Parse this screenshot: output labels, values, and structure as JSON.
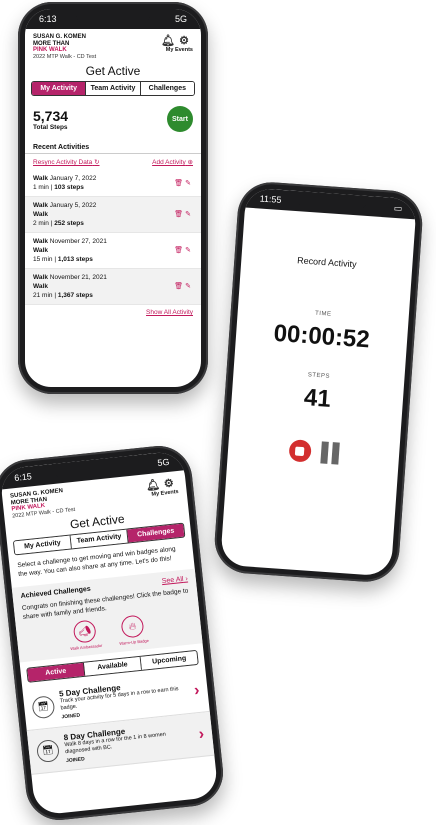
{
  "phone1": {
    "status": {
      "time": "6:13",
      "network": "5G"
    },
    "header": {
      "logo_line1": "SUSAN G. KOMEN",
      "logo_line2": "MORE THAN",
      "logo_line3": "PINK WALK",
      "logo_sub": "2022 MTP Walk - CD Test",
      "my_events": "My Events",
      "bell_icon": "bell-icon",
      "gear_icon": "gear-icon"
    },
    "title": "Get Active",
    "tabs": [
      "My Activity",
      "Team Activity",
      "Challenges"
    ],
    "steps": {
      "value": "5,734",
      "label": "Total Steps",
      "start_label": "Start"
    },
    "recent_heading": "Recent Activities",
    "resync_label": "Resync Activity Data",
    "add_label": "Add Activity",
    "activities": [
      {
        "type": "Walk",
        "date": "January 7, 2022",
        "subtype": "",
        "duration": "1 min",
        "steps": "103 steps"
      },
      {
        "type": "Walk",
        "date": "January 5, 2022",
        "subtype": "Walk",
        "duration": "2 min",
        "steps": "252 steps"
      },
      {
        "type": "Walk",
        "date": "November 27, 2021",
        "subtype": "Walk",
        "duration": "15 min",
        "steps": "1,013 steps"
      },
      {
        "type": "Walk",
        "date": "November 21, 2021",
        "subtype": "Walk",
        "duration": "21 min",
        "steps": "1,367 steps"
      }
    ],
    "show_all": "Show All Activity"
  },
  "phone2": {
    "status": {
      "time": "11:55"
    },
    "title": "Record Activity",
    "time_label": "TIME",
    "time_value": "00:00:52",
    "steps_label": "STEPS",
    "steps_value": "41"
  },
  "phone3": {
    "status": {
      "time": "6:15",
      "network": "5G"
    },
    "title": "Get Active",
    "tabs": [
      "My Activity",
      "Team Activity",
      "Challenges"
    ],
    "intro": "Select a challenge to get moving and win badges along the way. You can also share at any time. Let's do this!",
    "achieved": {
      "heading": "Achieved Challenges",
      "see_all": "See All",
      "text": "Congrats on finishing these challenges! Click the badge to share with family and friends.",
      "badges": [
        "Walk Ambassador",
        "Warm-Up Badge"
      ]
    },
    "subtabs": [
      "Active",
      "Available",
      "Upcoming"
    ],
    "challenges": [
      {
        "title": "5 Day Challenge",
        "desc": "Track your activity for 5 days in a row to earn this badge.",
        "status": "JOINED"
      },
      {
        "title": "8 Day Challenge",
        "desc": "Walk 8 days in a row for the 1 in 8 women diagnosed with BC.",
        "status": "JOINED"
      }
    ]
  },
  "colors": {
    "brand_pink": "#b5246a",
    "start_green": "#2e8b2e",
    "stop_red": "#d32f2f"
  }
}
